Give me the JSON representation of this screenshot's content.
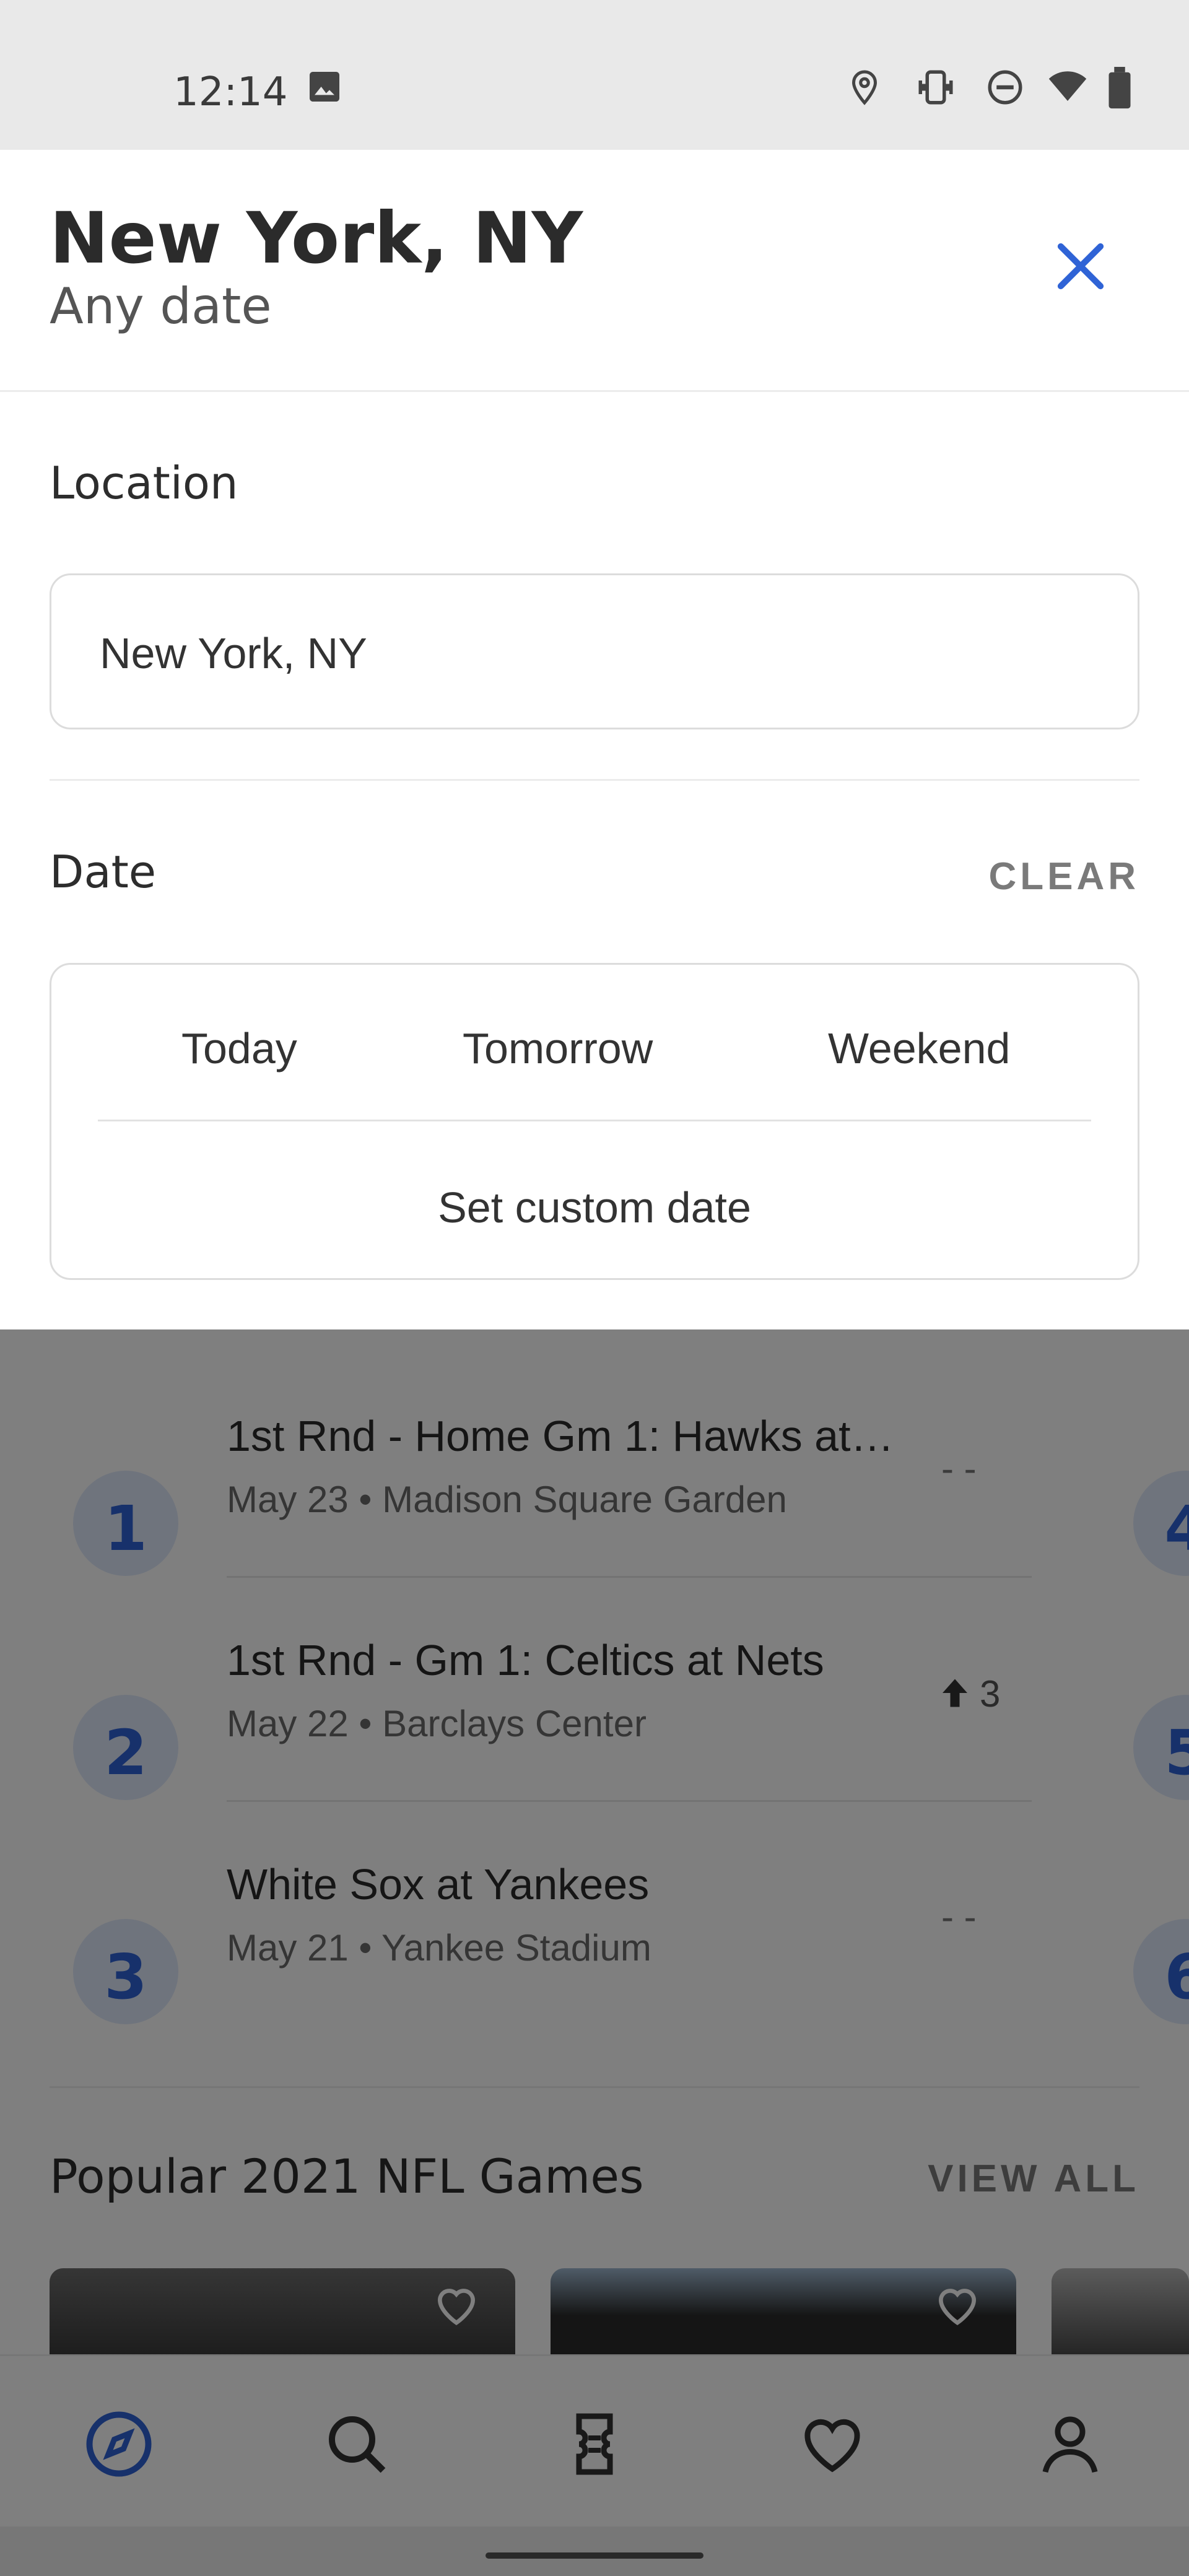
{
  "status_bar": {
    "time": "12:14"
  },
  "header": {
    "title": "New York, NY",
    "subtitle": "Any date"
  },
  "location": {
    "label": "Location",
    "value": "New York, NY"
  },
  "date": {
    "label": "Date",
    "clear_label": "CLEAR",
    "options": [
      "Today",
      "Tomorrow",
      "Weekend"
    ],
    "custom_label": "Set custom date"
  },
  "events": [
    {
      "rank": "1",
      "title": "1st Rnd - Home Gm 1: Hawks at…",
      "subtitle": "May 23 • Madison Square Garden",
      "trend": "- -"
    },
    {
      "rank": "2",
      "title": "1st Rnd - Gm 1: Celtics at Nets",
      "subtitle": "May 22 • Barclays Center",
      "trend": "3"
    },
    {
      "rank": "3",
      "title": "White Sox at Yankees",
      "subtitle": "May 21 • Yankee Stadium",
      "trend": "- -"
    }
  ],
  "peek_ranks": [
    "4",
    "5",
    "6"
  ],
  "nfl": {
    "title": "Popular 2021 NFL Games",
    "view_all": "VIEW ALL"
  },
  "bottom_nav": [
    "explore-icon",
    "search-icon",
    "tickets-icon",
    "favorites-icon",
    "profile-icon"
  ],
  "colors": {
    "accent": "#2f63d6",
    "close": "#2f63d6",
    "scrim": "rgba(0,0,0,0.5)"
  }
}
